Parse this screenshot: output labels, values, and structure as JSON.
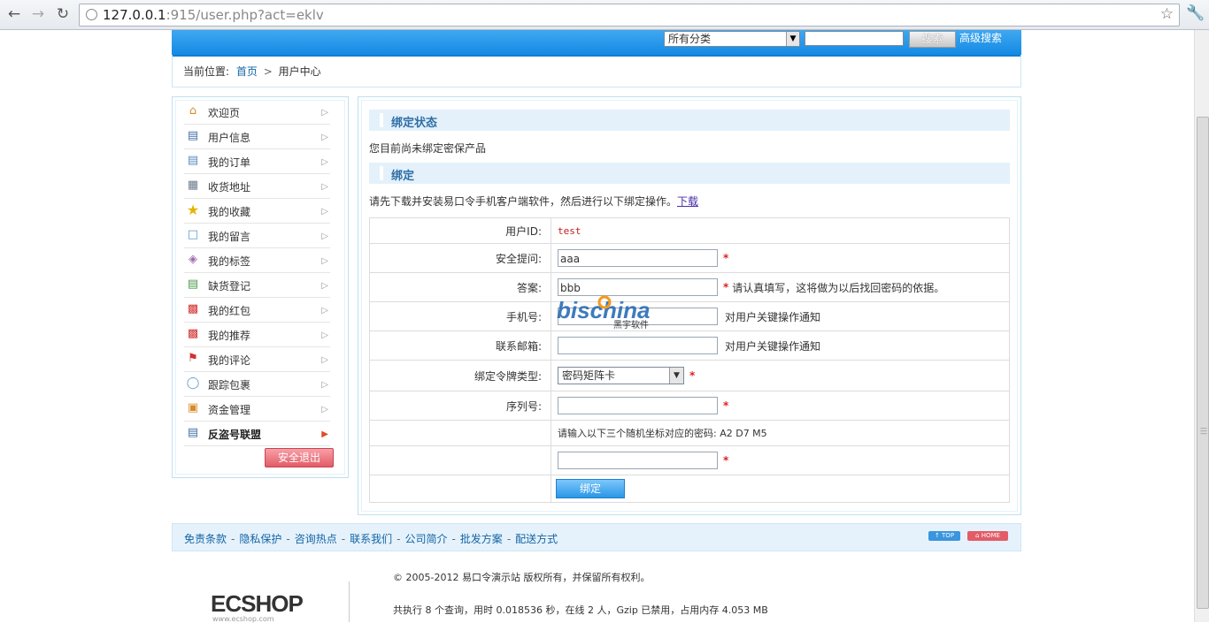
{
  "browser": {
    "url_host": "127.0.0.1",
    "url_rest": ":915/user.php?act=eklv"
  },
  "header": {
    "category_select": "所有分类",
    "search_button": "搜索",
    "advanced_search": "高级搜索"
  },
  "breadcrumb": {
    "prefix": "当前位置:",
    "home": "首页",
    "separator": ">",
    "current": "用户中心"
  },
  "sidebar": {
    "items": [
      {
        "label": "欢迎页",
        "icon": "home-icon"
      },
      {
        "label": "用户信息",
        "icon": "id-card-icon"
      },
      {
        "label": "我的订单",
        "icon": "document-icon"
      },
      {
        "label": "收货地址",
        "icon": "address-book-icon"
      },
      {
        "label": "我的收藏",
        "icon": "star-icon"
      },
      {
        "label": "我的留言",
        "icon": "speech-bubble-icon"
      },
      {
        "label": "我的标签",
        "icon": "tag-icon"
      },
      {
        "label": "缺货登记",
        "icon": "list-icon"
      },
      {
        "label": "我的红包",
        "icon": "red-envelope-icon"
      },
      {
        "label": "我的推荐",
        "icon": "recommend-icon"
      },
      {
        "label": "我的评论",
        "icon": "flag-icon"
      },
      {
        "label": "跟踪包裹",
        "icon": "package-track-icon"
      },
      {
        "label": "资金管理",
        "icon": "wallet-icon"
      },
      {
        "label": "反盗号联盟",
        "icon": "id-card-icon"
      }
    ],
    "logout": "安全退出"
  },
  "main": {
    "status_title": "绑定状态",
    "status_text": "您目前尚未绑定密保产品",
    "bind_title": "绑定",
    "instruction": "请先下载并安装易口令手机客户端软件，然后进行以下绑定操作。",
    "download_link": "下载",
    "form": {
      "user_id_label": "用户ID:",
      "user_id_value": "test",
      "question_label": "安全提问:",
      "question_value": "aaa",
      "answer_label": "答案:",
      "answer_value": "bbb",
      "answer_hint": "请认真填写，这将做为以后找回密码的依据。",
      "phone_label": "手机号:",
      "phone_hint": "对用户关键操作通知",
      "email_label": "联系邮箱:",
      "email_hint": "对用户关键操作通知",
      "token_type_label": "绑定令牌类型:",
      "token_type_value": "密码矩阵卡",
      "serial_label": "序列号:",
      "coord_prompt": "请输入以下三个随机坐标对应的密码: A2 D7 M5",
      "bind_button": "绑定",
      "required_mark": "*"
    }
  },
  "watermark": {
    "brand": "bischina",
    "sub": "黑宇软件"
  },
  "footer": {
    "links": [
      "免责条款",
      "隐私保护",
      "咨询热点",
      "联系我们",
      "公司简介",
      "批发方案",
      "配送方式"
    ],
    "top_button": "TOP",
    "home_button": "HOME",
    "copyright": "© 2005-2012 易口令演示站 版权所有，并保留所有权利。",
    "stats": "共执行 8 个查询，用时 0.018536 秒，在线 2 人，Gzip 已禁用，占用内存 4.053 MB",
    "logo": "ECSHOP",
    "logo_url": "www.ecshop.com"
  }
}
